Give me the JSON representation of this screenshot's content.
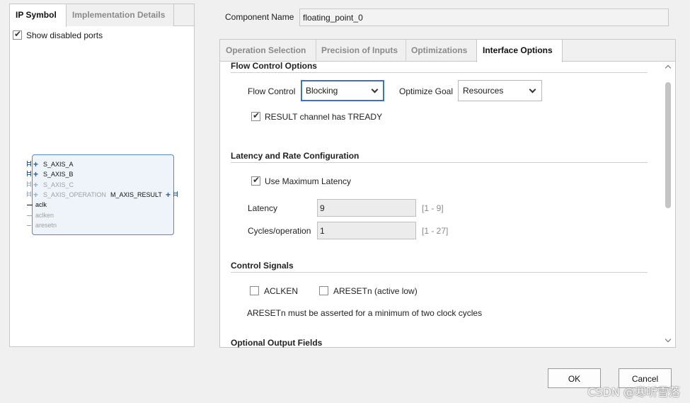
{
  "left_panel": {
    "tabs": [
      {
        "label": "IP Symbol",
        "active": true
      },
      {
        "label": "Implementation Details",
        "active": false
      }
    ],
    "show_disabled_ports": {
      "label": "Show disabled ports",
      "checked": true
    },
    "ip_symbol": {
      "left_bus_ports": [
        {
          "name": "S_AXIS_A",
          "enabled": true
        },
        {
          "name": "S_AXIS_B",
          "enabled": true
        },
        {
          "name": "S_AXIS_C",
          "enabled": false
        },
        {
          "name": "S_AXIS_OPERATION",
          "enabled": false
        }
      ],
      "left_signal_ports": [
        {
          "name": "aclk",
          "enabled": true
        },
        {
          "name": "aclken",
          "enabled": false
        },
        {
          "name": "aresetn",
          "enabled": false
        }
      ],
      "right_bus_port": {
        "name": "M_AXIS_RESULT",
        "enabled": true
      }
    }
  },
  "component_name": {
    "label": "Component Name",
    "value": "floating_point_0"
  },
  "tabs": [
    {
      "label": "Operation Selection",
      "active": false
    },
    {
      "label": "Precision of Inputs",
      "active": false
    },
    {
      "label": "Optimizations",
      "active": false
    },
    {
      "label": "Interface Options",
      "active": true
    }
  ],
  "flow_control_options": {
    "title": "Flow Control Options",
    "flow_control": {
      "label": "Flow Control",
      "value": "Blocking"
    },
    "optimize_goal": {
      "label": "Optimize Goal",
      "value": "Resources"
    },
    "result_tready": {
      "label": "RESULT channel has TREADY",
      "checked": true
    }
  },
  "latency": {
    "title": "Latency and Rate Configuration",
    "use_max_latency": {
      "label": "Use Maximum Latency",
      "checked": true
    },
    "latency": {
      "label": "Latency",
      "value": "9",
      "range": "[1 - 9]"
    },
    "cycles": {
      "label": "Cycles/operation",
      "value": "1",
      "range": "[1 - 27]"
    }
  },
  "control_signals": {
    "title": "Control Signals",
    "aclken": {
      "label": "ACLKEN",
      "checked": false
    },
    "aresetn": {
      "label": "ARESETn (active low)",
      "checked": false
    },
    "note": "ARESETn must be asserted for a minimum of two clock cycles"
  },
  "optional_output_fields": {
    "title": "Optional Output Fields"
  },
  "buttons": {
    "ok": "OK",
    "cancel": "Cancel"
  },
  "watermark": "CSDN @寒听雪落",
  "colors": {
    "accent": "#3b74c2",
    "ip_box": "#5a8ab8"
  }
}
